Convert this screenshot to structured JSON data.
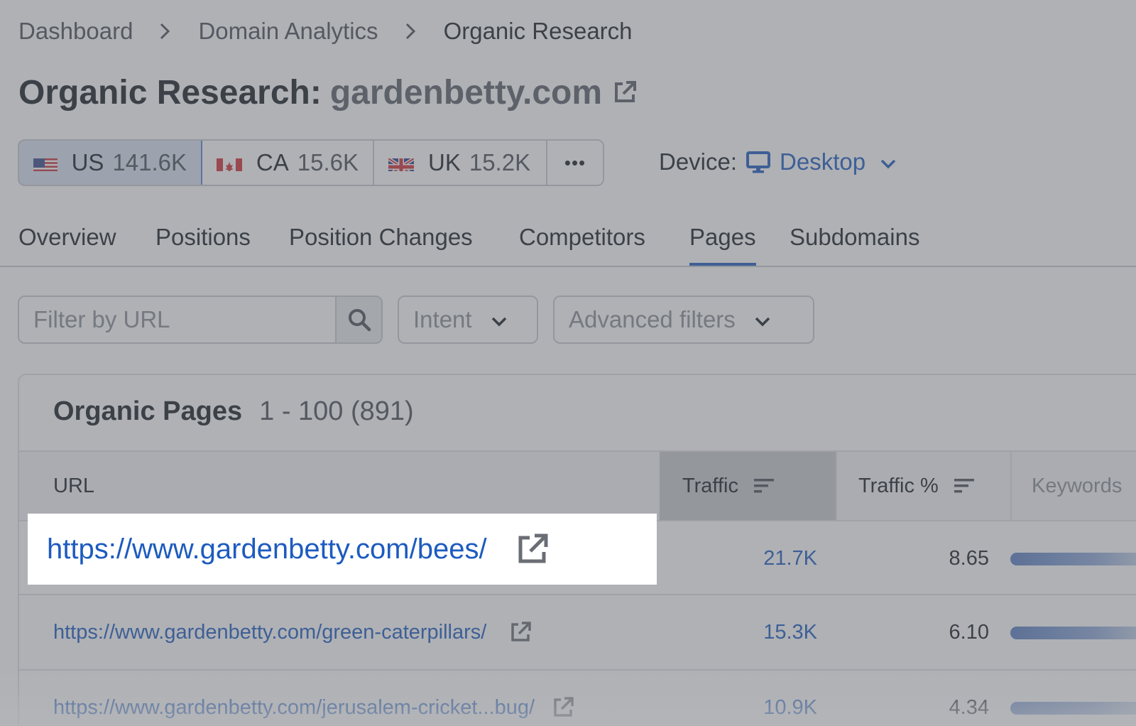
{
  "breadcrumb": {
    "items": [
      "Dashboard",
      "Domain Analytics",
      "Organic Research"
    ]
  },
  "title": {
    "main": "Organic Research:",
    "domain": "gardenbetty.com"
  },
  "databases": [
    {
      "code": "US",
      "value": "141.6K",
      "selected": true
    },
    {
      "code": "CA",
      "value": "15.6K",
      "selected": false
    },
    {
      "code": "UK",
      "value": "15.2K",
      "selected": false
    }
  ],
  "more_label": "•••",
  "device": {
    "label": "Device:",
    "value": "Desktop"
  },
  "tabs": [
    "Overview",
    "Positions",
    "Position Changes",
    "Competitors",
    "Pages",
    "Subdomains"
  ],
  "active_tab": "Pages",
  "filters": {
    "url_placeholder": "Filter by URL",
    "intent_label": "Intent",
    "advanced_label": "Advanced filters"
  },
  "table": {
    "title": "Organic Pages",
    "count": "1 - 100 (891)",
    "columns": {
      "url": "URL",
      "traffic": "Traffic",
      "traffic_pct": "Traffic %",
      "keywords": "Keywords"
    },
    "rows": [
      {
        "url": "https://www.gardenbetty.com/bees/",
        "traffic": "21.7K",
        "traffic_pct": "8.65"
      },
      {
        "url": "https://www.gardenbetty.com/green-caterpillars/",
        "traffic": "15.3K",
        "traffic_pct": "6.10"
      },
      {
        "url": "https://www.gardenbetty.com/jerusalem-cricket...bug/",
        "traffic": "10.9K",
        "traffic_pct": "4.34"
      }
    ]
  },
  "colors": {
    "link": "#1d5bbf",
    "accent": "#1d5bbf",
    "overlay": "#60646c"
  }
}
